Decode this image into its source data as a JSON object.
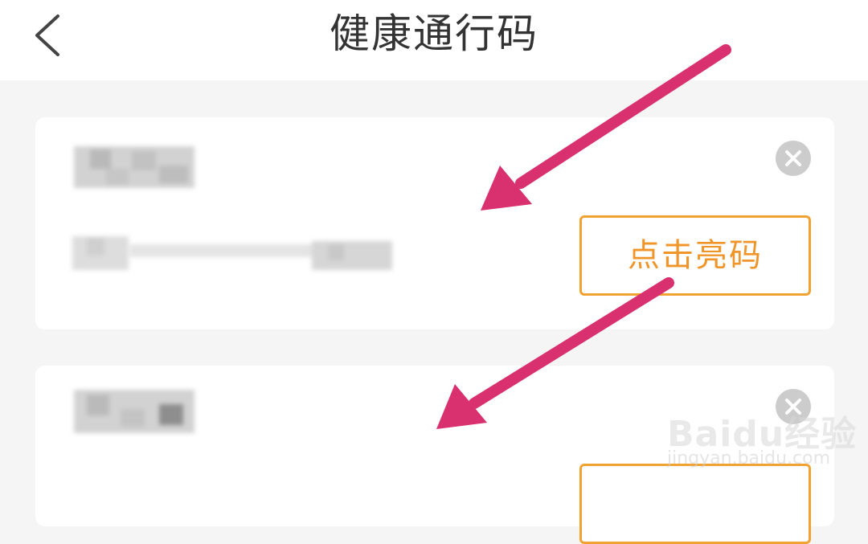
{
  "header": {
    "title": "健康通行码",
    "back_icon": "chevron-left-icon"
  },
  "cards": [
    {
      "button_label": "点击亮码",
      "close_icon": "close-circle-icon"
    },
    {
      "button_label": "",
      "close_icon": "close-circle-icon"
    }
  ],
  "watermark": {
    "logo_text": "Baidu经验",
    "url": "jingyan.baidu.com"
  },
  "colors": {
    "accent": "#f0a232",
    "annotation_arrow": "#d9306f",
    "background": "#f5f5f5"
  }
}
